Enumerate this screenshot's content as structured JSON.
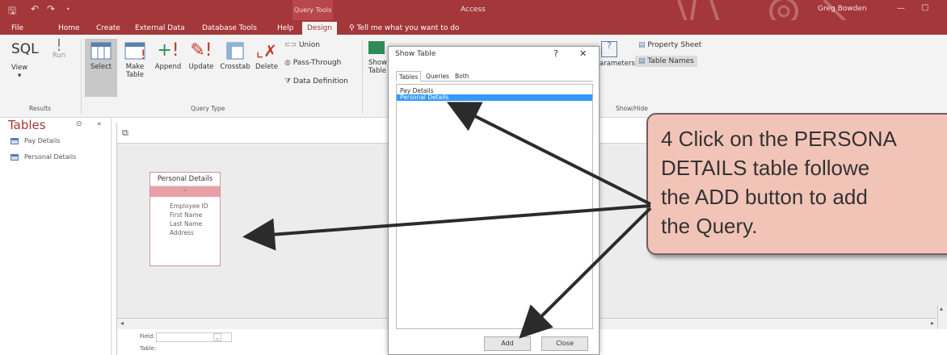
{
  "titlebar": {
    "context_tab": "Query Tools",
    "app_title": "Access",
    "user": "Greg Bowden"
  },
  "tabs": {
    "items": [
      "File",
      "Home",
      "Create",
      "External Data",
      "Database Tools",
      "Help",
      "Design"
    ],
    "active": "Design",
    "tell_me": "Tell me what you want to do"
  },
  "ribbon": {
    "results": {
      "sql": "SQL",
      "view": "View",
      "run": "Run",
      "label": "Results"
    },
    "query_type": {
      "select": "Select",
      "make_table": "Make Table",
      "append": "Append",
      "update": "Update",
      "crosstab": "Crosstab",
      "delete": "Delete",
      "union": "Union",
      "pass_through": "Pass-Through",
      "data_definition": "Data Definition",
      "label": "Query Type"
    },
    "setup": {
      "show": "Show",
      "table": "Table",
      "parameters": "arameters"
    },
    "show_hide": {
      "property_sheet": "Property Sheet",
      "table_names": "Table Names",
      "label": "Show/Hide"
    }
  },
  "nav": {
    "title": "Tables",
    "items": [
      "Pay Details",
      "Personal Details"
    ]
  },
  "field_list": {
    "title": "Personal Details",
    "star": "*",
    "fields": [
      "Employee ID",
      "First Name",
      "Last Name",
      "Address"
    ]
  },
  "grid": {
    "field_label": "Field:",
    "table_label": "Table:"
  },
  "dialog": {
    "title": "Show Table",
    "help": "?",
    "close": "✕",
    "tabs": [
      "Tables",
      "Queries",
      "Both"
    ],
    "active_tab": "Tables",
    "items": [
      "Pay Details",
      "Personal Details"
    ],
    "selected": "Personal Details",
    "add_button": "Add",
    "close_button": "Close"
  },
  "callout": {
    "text": "4  Click on the PERSONA\nDETAILS table followe\nthe ADD button to add\nthe Query."
  },
  "colors": {
    "access_red": "#a4373a",
    "callout_fill": "#f2c4b8",
    "selection_blue": "#3399ff"
  }
}
